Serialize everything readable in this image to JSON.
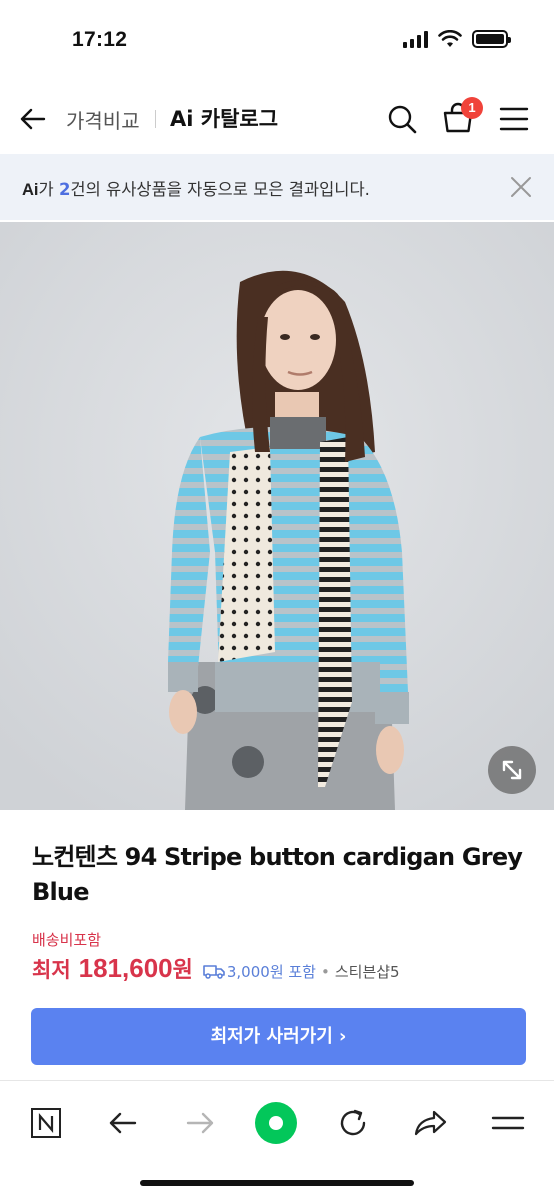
{
  "status_bar": {
    "time": "17:12"
  },
  "header": {
    "breadcrumb": "가격비교",
    "title": "Ai 카탈로그",
    "cart_count": "1"
  },
  "ai_banner": {
    "logo": "Ai",
    "text_before": "가 ",
    "count": "2",
    "text_after": "건의 유사상품을 자동으로 모은 결과입니다."
  },
  "product": {
    "name": "노컨텐츠 94 Stripe button cardigan Grey Blue",
    "shipping_label": "배송비포함",
    "price_prefix": "최저",
    "price": "181,600",
    "price_unit": "원",
    "shipping_fee": "3,000원 포함",
    "seller": "스티븐샵5"
  },
  "buy_button": {
    "label": "최저가 사러가기 ›"
  },
  "icons": {
    "back": "arrow-left-icon",
    "search": "search-icon",
    "cart": "shopping-bag-icon",
    "menu": "hamburger-icon",
    "close": "close-icon",
    "expand": "expand-diagonal-icon",
    "truck": "truck-icon",
    "nav": [
      "naver-n-icon",
      "back-arrow-icon",
      "forward-arrow-icon",
      "green-home-icon",
      "refresh-icon",
      "share-icon",
      "menu-icon"
    ]
  },
  "colors": {
    "accent_blue": "#5a82f0",
    "price_red": "#d8344b",
    "badge_red": "#f0433a",
    "banner_bg": "#eef2f8",
    "naver_green": "#03c75a"
  }
}
